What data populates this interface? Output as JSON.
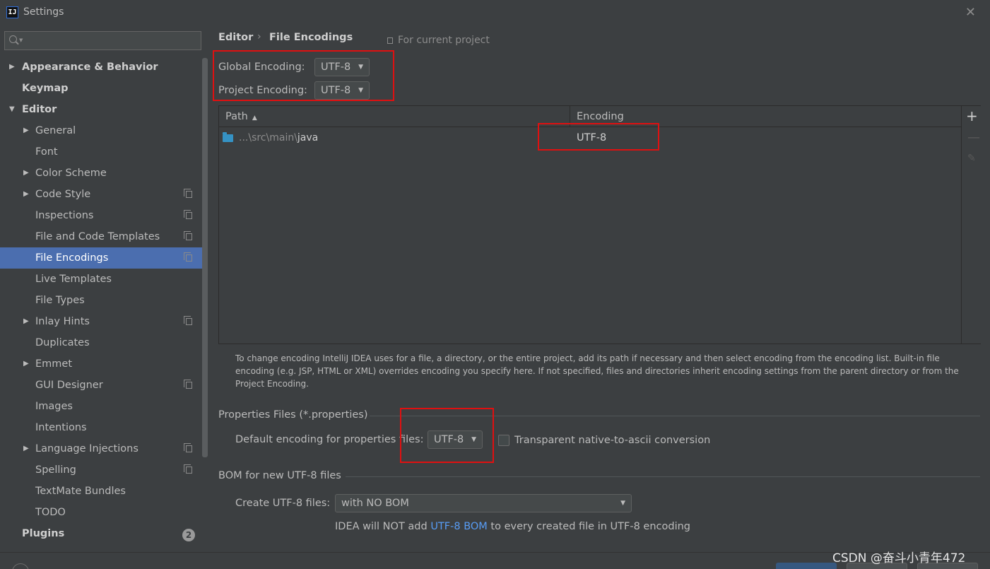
{
  "window": {
    "title": "Settings",
    "close_glyph": "✕"
  },
  "sidebar": {
    "search": {
      "value": "",
      "placeholder": ""
    },
    "items": [
      {
        "label": "Appearance & Behavior",
        "level": 0,
        "bold": true,
        "arrow": "▶",
        "copy": false
      },
      {
        "label": "Keymap",
        "level": 0,
        "bold": true,
        "arrow": "",
        "copy": false
      },
      {
        "label": "Editor",
        "level": 0,
        "bold": true,
        "arrow": "▼",
        "copy": false
      },
      {
        "label": "General",
        "level": 1,
        "bold": false,
        "arrow": "▶",
        "copy": false
      },
      {
        "label": "Font",
        "level": 1,
        "bold": false,
        "arrow": "",
        "copy": false
      },
      {
        "label": "Color Scheme",
        "level": 1,
        "bold": false,
        "arrow": "▶",
        "copy": false
      },
      {
        "label": "Code Style",
        "level": 1,
        "bold": false,
        "arrow": "▶",
        "copy": true
      },
      {
        "label": "Inspections",
        "level": 1,
        "bold": false,
        "arrow": "",
        "copy": true
      },
      {
        "label": "File and Code Templates",
        "level": 1,
        "bold": false,
        "arrow": "",
        "copy": true
      },
      {
        "label": "File Encodings",
        "level": 1,
        "bold": false,
        "arrow": "",
        "copy": true,
        "selected": true
      },
      {
        "label": "Live Templates",
        "level": 1,
        "bold": false,
        "arrow": "",
        "copy": false
      },
      {
        "label": "File Types",
        "level": 1,
        "bold": false,
        "arrow": "",
        "copy": false
      },
      {
        "label": "Inlay Hints",
        "level": 1,
        "bold": false,
        "arrow": "▶",
        "copy": true
      },
      {
        "label": "Duplicates",
        "level": 1,
        "bold": false,
        "arrow": "",
        "copy": false
      },
      {
        "label": "Emmet",
        "level": 1,
        "bold": false,
        "arrow": "▶",
        "copy": false
      },
      {
        "label": "GUI Designer",
        "level": 1,
        "bold": false,
        "arrow": "",
        "copy": true
      },
      {
        "label": "Images",
        "level": 1,
        "bold": false,
        "arrow": "",
        "copy": false
      },
      {
        "label": "Intentions",
        "level": 1,
        "bold": false,
        "arrow": "",
        "copy": false
      },
      {
        "label": "Language Injections",
        "level": 1,
        "bold": false,
        "arrow": "▶",
        "copy": true
      },
      {
        "label": "Spelling",
        "level": 1,
        "bold": false,
        "arrow": "",
        "copy": true
      },
      {
        "label": "TextMate Bundles",
        "level": 1,
        "bold": false,
        "arrow": "",
        "copy": false
      },
      {
        "label": "TODO",
        "level": 1,
        "bold": false,
        "arrow": "",
        "copy": false
      },
      {
        "label": "Plugins",
        "level": 0,
        "bold": true,
        "arrow": "",
        "copy": false,
        "badge": "2"
      }
    ]
  },
  "breadcrumb": {
    "parent": "Editor",
    "separator": "›",
    "current": "File Encodings",
    "scope": "For current project"
  },
  "global_encoding": {
    "label": "Global Encoding:",
    "value": "UTF-8"
  },
  "project_encoding": {
    "label": "Project Encoding:",
    "value": "UTF-8"
  },
  "table": {
    "columns": [
      "Path",
      "Encoding"
    ],
    "sort_glyph": "▲",
    "rows": [
      {
        "path_prefix": "...\\src\\main\\",
        "path_name": "java",
        "encoding": "UTF-8"
      }
    ],
    "add_glyph": "+",
    "remove_glyph": "—",
    "edit_glyph": "✎"
  },
  "help_text": "To change encoding IntelliJ IDEA uses for a file, a directory, or the entire project, add its path if necessary and then select encoding from the encoding list. Built-in file encoding (e.g. JSP, HTML or XML) overrides encoding you specify here. If not specified, files and directories inherit encoding settings from the parent directory or from the Project Encoding.",
  "properties": {
    "section_title": "Properties Files (*.properties)",
    "default_label": "Default encoding for properties files:",
    "default_value": "UTF-8",
    "transparent_label": "Transparent native-to-ascii conversion",
    "transparent_checked": false
  },
  "bom": {
    "section_title": "BOM for new UTF-8 files",
    "create_label": "Create UTF-8 files:",
    "create_value": "with NO BOM",
    "note_before": "IDEA will NOT add ",
    "note_link": "UTF-8 BOM",
    "note_after": " to every created file in UTF-8 encoding"
  },
  "watermark": "CSDN @奋斗小青年472",
  "colors": {
    "accent": "#4b6eaf",
    "highlight": "#e01010",
    "link": "#589df6",
    "background": "#3c3f41"
  }
}
